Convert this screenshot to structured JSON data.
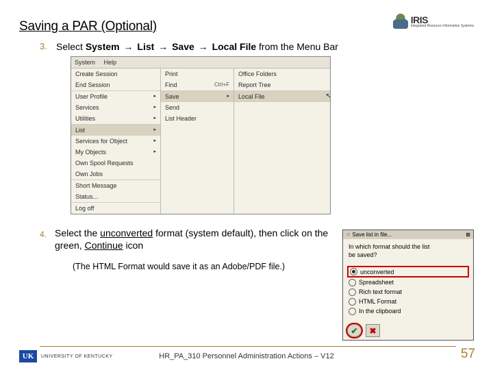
{
  "title": "Saving a PAR (Optional)",
  "logo": {
    "name": "IRIS",
    "sub": "Integrated Resource\nInformation Systems"
  },
  "step3": {
    "num": "3.",
    "prefix": "Select ",
    "path": [
      "System",
      "List",
      "Save",
      "Local File"
    ],
    "suffix": " from the Menu Bar"
  },
  "menu": {
    "bar": [
      "System",
      "Help"
    ],
    "col1": [
      "Create Session",
      "End Session",
      "User Profile",
      "Services",
      "Utilities",
      "List",
      "Services for Object",
      "My Objects",
      "Own Spool Requests",
      "Own Jobs",
      "Short Message",
      "Status...",
      "Log off"
    ],
    "col2": [
      {
        "label": "Print",
        "kbd": ""
      },
      {
        "label": "Find",
        "kbd": "Ctrl+F"
      },
      {
        "label": "Save",
        "kbd": ""
      },
      {
        "label": "Send",
        "kbd": ""
      },
      {
        "label": "List Header",
        "kbd": ""
      }
    ],
    "col3": [
      "Office Folders",
      "Report Tree",
      "Local File"
    ]
  },
  "step4": {
    "num": "4.",
    "line1_a": "Select the ",
    "line1_b": "unconverted",
    "line1_c": " format (system default), then click on the green, ",
    "line1_d": "Continue",
    "line1_e": " icon",
    "sub_a": "(The ",
    "sub_b": "HTML Format",
    "sub_c": " would save it as an Adobe/PDF file.)"
  },
  "dialog": {
    "title": "Save list in file...",
    "question": "In which format should the list",
    "question2": "be saved?",
    "options": [
      "unconverted",
      "Spreadsheet",
      "Rich text format",
      "HTML Format",
      "In the clipboard"
    ]
  },
  "footer": {
    "uk": "UK",
    "uk_name": "UNIVERSITY OF KENTUCKY",
    "doc": "HR_PA_310 Personnel Administration Actions – V12",
    "page": "57"
  }
}
